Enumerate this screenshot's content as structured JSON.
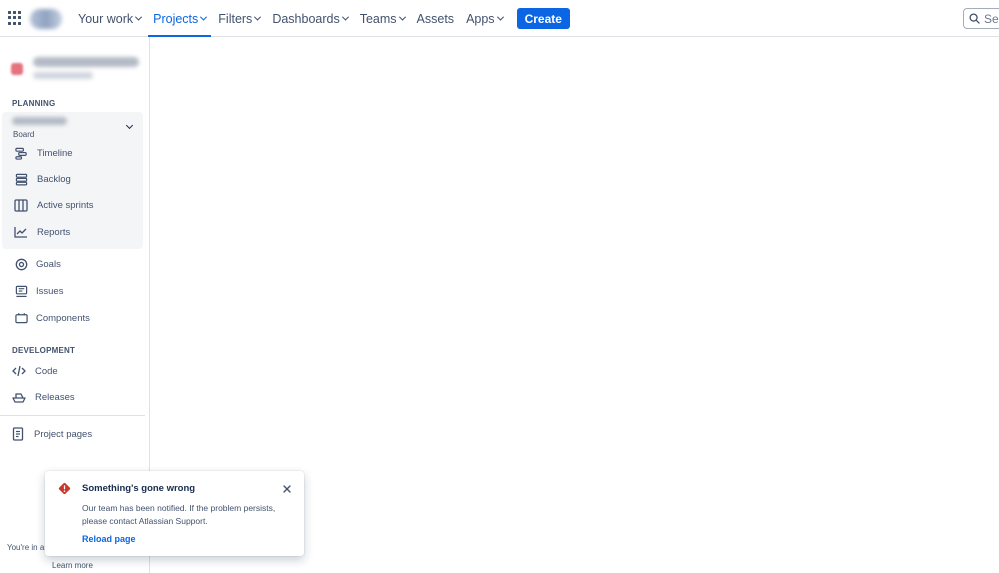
{
  "topnav": {
    "app_switcher_icon": "grid-icon",
    "items": [
      {
        "label": "Your work",
        "dropdown": true,
        "active": false
      },
      {
        "label": "Projects",
        "dropdown": true,
        "active": true
      },
      {
        "label": "Filters",
        "dropdown": true,
        "active": false
      },
      {
        "label": "Dashboards",
        "dropdown": true,
        "active": false
      },
      {
        "label": "Teams",
        "dropdown": true,
        "active": false
      },
      {
        "label": "Assets",
        "dropdown": false,
        "active": false
      },
      {
        "label": "Apps",
        "dropdown": true,
        "active": false
      }
    ],
    "create_label": "Create",
    "search_placeholder": "Sea",
    "accent_color": "#0c66e4"
  },
  "sidebar": {
    "planning_label": "PLANNING",
    "board_label": "Board",
    "planning_items": [
      {
        "label": "Timeline",
        "icon": "timeline-icon"
      },
      {
        "label": "Backlog",
        "icon": "backlog-icon"
      },
      {
        "label": "Active sprints",
        "icon": "board-columns-icon"
      },
      {
        "label": "Reports",
        "icon": "chart-line-icon"
      }
    ],
    "other_items": [
      {
        "label": "Goals",
        "icon": "target-icon"
      },
      {
        "label": "Issues",
        "icon": "issues-icon"
      },
      {
        "label": "Components",
        "icon": "component-icon"
      }
    ],
    "development_label": "DEVELOPMENT",
    "development_items": [
      {
        "label": "Code",
        "icon": "code-icon"
      },
      {
        "label": "Releases",
        "icon": "ship-icon"
      }
    ],
    "project_pages_label": "Project pages",
    "footer_text": "You're in a c",
    "learn_more_label": "Learn more"
  },
  "error_flag": {
    "title": "Something's gone wrong",
    "body": "Our team has been notified. If the problem persists, please contact Atlassian Support.",
    "action_label": "Reload page",
    "icon_color": "#c9372c"
  }
}
